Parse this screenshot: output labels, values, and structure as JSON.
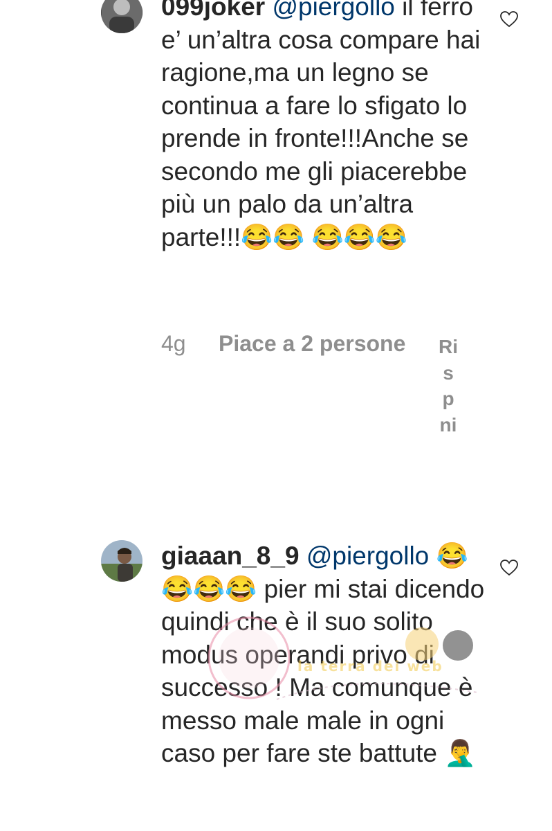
{
  "comments": [
    {
      "username": "099joker",
      "mention": "@piergollo",
      "text": "il ferro e’ un’altra cosa compare hai ragione,ma un legno se continua a fare lo sfigato lo prende in fronte!!!Anche se secondo me gli piacerebbe più un palo da un’altra parte!!!😂😂 😂😂😂",
      "time": "4g",
      "likes": "Piace a 2 persone",
      "reply": "Rispni"
    },
    {
      "username": "giaaan_8_9",
      "mention": "@piergollo",
      "text": "😂😂😂😂 pier mi stai dicendo quindi che è il suo solito modus operandi privo di successo ! Ma comunque è messo male male in ogni caso per fare ste battute 🤦‍♂️"
    }
  ],
  "watermark": {
    "text": "la terra dei web"
  },
  "icons": {
    "heart": "heart-outline-icon",
    "avatar1": "avatar-photo",
    "avatar2": "avatar-photo"
  },
  "colors": {
    "text": "#262626",
    "meta": "#8e8e8e",
    "mention": "#00376b"
  }
}
